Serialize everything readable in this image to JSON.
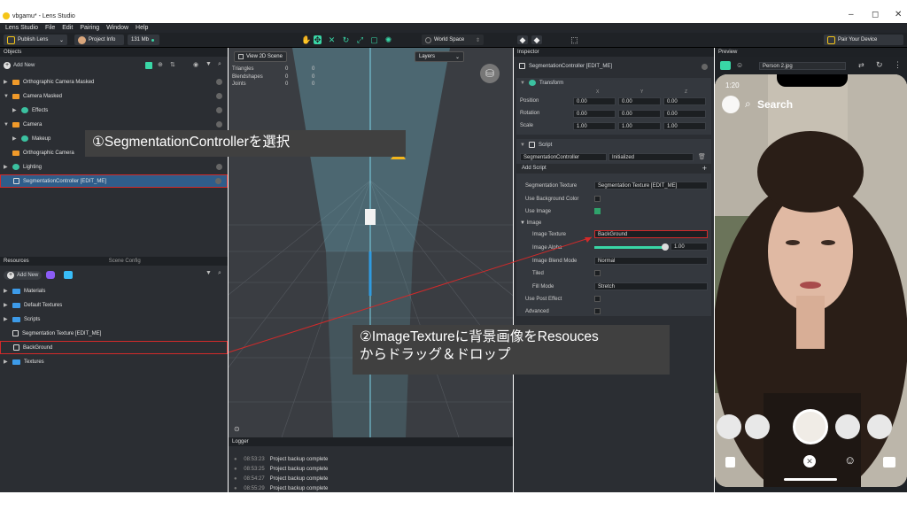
{
  "window": {
    "title": "vbgamu* - Lens Studio",
    "minimize": "–",
    "maximize": "◻",
    "close": "✕"
  },
  "menu": [
    "Lens Studio",
    "File",
    "Edit",
    "Pairing",
    "Window",
    "Help"
  ],
  "toolbar": {
    "publish": "Publish Lens",
    "project_info": "Project Info",
    "size": "131 Mb",
    "world_space": "World Space",
    "pair": "Pair Your Device"
  },
  "objects": {
    "title": "Objects",
    "add_new": "Add New",
    "items": [
      {
        "label": "Orthographic Camera Masked",
        "icon": "camera-orange",
        "indent": 0,
        "caret": "▶"
      },
      {
        "label": "Camera Masked",
        "icon": "camera-orange",
        "indent": 0,
        "caret": "▼"
      },
      {
        "label": "Effects",
        "icon": "effect-green",
        "indent": 1,
        "caret": "▶"
      },
      {
        "label": "Camera",
        "icon": "camera-orange",
        "indent": 0,
        "caret": "▼"
      },
      {
        "label": "Makeup",
        "icon": "effect-green",
        "indent": 1,
        "caret": "▶"
      },
      {
        "label": "Orthographic Camera",
        "icon": "camera-orange",
        "indent": 0,
        "caret": ""
      },
      {
        "label": "Lighting",
        "icon": "light-green",
        "indent": 0,
        "caret": "▶"
      },
      {
        "label": "SegmentationController [EDIT_ME]",
        "icon": "script-white",
        "indent": 0,
        "caret": "",
        "selected": true
      }
    ]
  },
  "resources": {
    "tabs": [
      "Resources",
      "Scene Config"
    ],
    "add_new": "Add New",
    "items": [
      {
        "label": "Materials",
        "icon": "folder",
        "caret": "▶"
      },
      {
        "label": "Default Textures",
        "icon": "folder",
        "caret": "▶"
      },
      {
        "label": "Scripts",
        "icon": "folder",
        "caret": "▶"
      },
      {
        "label": "Segmentation Texture [EDIT_ME]",
        "icon": "texture",
        "caret": ""
      },
      {
        "label": "BackGround",
        "icon": "image",
        "caret": ""
      },
      {
        "label": "Textures",
        "icon": "folder",
        "caret": "▶"
      }
    ]
  },
  "viewport": {
    "view2d": "View 2D Scene",
    "layers": "Layers",
    "stats": [
      {
        "label": "Triangles",
        "a": "0",
        "b": "0"
      },
      {
        "label": "Blendshapes",
        "a": "0",
        "b": "0"
      },
      {
        "label": "Joints",
        "a": "0",
        "b": "0"
      }
    ]
  },
  "logger": {
    "title": "Logger",
    "rows": [
      {
        "time": "08:53:23",
        "msg": "Project backup complete"
      },
      {
        "time": "08:53:25",
        "msg": "Project backup complete"
      },
      {
        "time": "08:54:27",
        "msg": "Project backup complete"
      },
      {
        "time": "08:55:29",
        "msg": "Project backup complete"
      }
    ]
  },
  "inspector": {
    "title": "Inspector",
    "object_name": "SegmentationController [EDIT_ME]",
    "transform": {
      "title": "Transform",
      "axes": [
        "X",
        "Y",
        "Z"
      ],
      "position": [
        "0.00",
        "0.00",
        "0.00"
      ],
      "rotation": [
        "0.00",
        "0.00",
        "0.00"
      ],
      "scale": [
        "1.00",
        "1.00",
        "1.00"
      ],
      "labels": [
        "Position",
        "Rotation",
        "Scale"
      ]
    },
    "script": {
      "title": "Script",
      "name": "SegmentationController",
      "status": "Initialized",
      "add_script": "Add Script",
      "seg_texture_label": "Segmentation Texture",
      "seg_texture_value": "Segmentation Texture [EDIT_ME]",
      "use_bg_color": "Use Background Color",
      "use_image": "Use Image",
      "image_group": "Image",
      "image_texture_label": "Image Texture",
      "image_texture_value": "BackGround",
      "image_alpha_label": "Image Alpha",
      "image_alpha_value": "1.00",
      "blend_label": "Image Blend Mode",
      "blend_value": "Normal",
      "tiled": "Tiled",
      "fill_label": "Fill Mode",
      "fill_value": "Stretch",
      "use_post": "Use Post Effect",
      "advanced": "Advanced"
    }
  },
  "preview": {
    "title": "Preview",
    "person": "Person 2.jpg",
    "time": "1:20",
    "search": "Search"
  },
  "callouts": {
    "one": "①SegmentationControllerを選択",
    "two_line1": "②ImageTextureに背景画像をResouces",
    "two_line2": "からドラッグ＆ドロップ"
  },
  "colors": {
    "accent": "#39d6a6",
    "selection": "#2f5d8a",
    "highlight": "#d22a2a"
  }
}
